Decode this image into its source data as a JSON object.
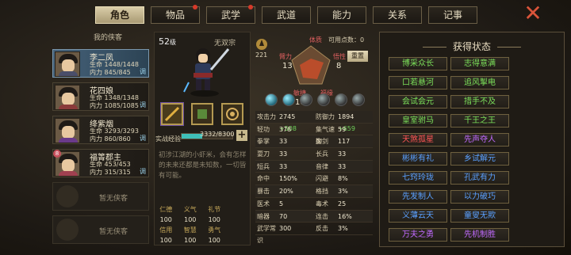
{
  "tabs": [
    {
      "label": "角色",
      "active": true
    },
    {
      "label": "物品",
      "dot": true
    },
    {
      "label": "武学",
      "dot": true
    },
    {
      "label": "武道"
    },
    {
      "label": "能力"
    },
    {
      "label": "关系"
    },
    {
      "label": "记事"
    }
  ],
  "close_icon": "close-icon",
  "party": {
    "title": "我的侠客",
    "members": [
      {
        "name": "李二凤",
        "hp": "生命 1448/1448",
        "mp": "内力 845/845",
        "tag": "调",
        "selected": true
      },
      {
        "name": "花四娘",
        "hp": "生命 1348/1348",
        "mp": "内力 1085/1085",
        "tag": "调"
      },
      {
        "name": "绛紫烟",
        "hp": "生命 3293/3293",
        "mp": "内力 860/860",
        "tag": "调"
      },
      {
        "name": "福箐郡主",
        "hp": "生命 453/453",
        "mp": "内力 315/315",
        "tag": "调",
        "badge": "8"
      }
    ],
    "empty_label": "暂无侠客"
  },
  "hero": {
    "level": "52",
    "level_unit": "级",
    "sect": "无双宗",
    "xp_label": "实战经验",
    "xp_text": "3332/8300",
    "xp_fraction": 0.401,
    "bio": "初涉江湖的小虾米，会有怎样的未来还都是未知数，一切皆有可能。"
  },
  "virtues": [
    {
      "k": "仁德",
      "v": "100"
    },
    {
      "k": "义气",
      "v": "100"
    },
    {
      "k": "礼节",
      "v": "100"
    },
    {
      "k": "",
      "v": ""
    },
    {
      "k": "信用",
      "v": "100"
    },
    {
      "k": "智慧",
      "v": "100"
    },
    {
      "k": "勇气",
      "v": "100"
    },
    {
      "k": "",
      "v": ""
    }
  ],
  "attributes": {
    "fame": "221",
    "points_label": "可用点数：0",
    "reset_label": "重置",
    "items": [
      {
        "k": "体质",
        "v": ""
      },
      {
        "k": "臂力",
        "v": "13"
      },
      {
        "k": "悟性",
        "v": "8"
      },
      {
        "k": "敏捷",
        "v": "10"
      },
      {
        "k": "福缘",
        "v": "9"
      }
    ]
  },
  "stats": [
    {
      "k": "攻击力",
      "v": "2745",
      "plus": "+508",
      "k2": "防御力",
      "v2": "1894",
      "plus2": "+659"
    },
    {
      "k": "轻功",
      "v": "378",
      "k2": "集气速度",
      "v2": "59"
    },
    {
      "k": "拳掌",
      "v": "33",
      "k2": "御剑",
      "v2": "117"
    },
    {
      "k": "耍刀",
      "v": "33",
      "k2": "长兵",
      "v2": "33"
    },
    {
      "k": "短兵",
      "v": "33",
      "k2": "音律",
      "v2": "33"
    },
    {
      "k": "命中",
      "v": "150%",
      "k2": "闪避",
      "v2": "8%"
    },
    {
      "k": "暴击",
      "v": "20%",
      "k2": "格挡",
      "v2": "3%"
    },
    {
      "k": "医术",
      "v": "5",
      "k2": "毒术",
      "v2": "25"
    },
    {
      "k": "暗器",
      "v": "70",
      "k2": "连击",
      "v2": "16%"
    },
    {
      "k": "武学常识",
      "v": "300",
      "k2": "反击",
      "v2": "3%"
    }
  ],
  "status": {
    "title": "获得状态",
    "items": [
      {
        "label": "博采众长",
        "color": "green"
      },
      {
        "label": "志得意满",
        "color": "green"
      },
      {
        "label": "口若悬河",
        "color": "green"
      },
      {
        "label": "追风掣电",
        "color": "green"
      },
      {
        "label": "会试会元",
        "color": "green"
      },
      {
        "label": "措手不及",
        "color": "green"
      },
      {
        "label": "皇室驸马",
        "color": "green"
      },
      {
        "label": "千王之王",
        "color": "green"
      },
      {
        "label": "天煞孤星",
        "color": "red"
      },
      {
        "label": "先声夺人",
        "color": "purple"
      },
      {
        "label": "彬彬有礼",
        "color": "blue"
      },
      {
        "label": "乡试解元",
        "color": "blue"
      },
      {
        "label": "七窍玲珑",
        "color": "blue"
      },
      {
        "label": "孔武有力",
        "color": "blue"
      },
      {
        "label": "先发制人",
        "color": "blue"
      },
      {
        "label": "以力破巧",
        "color": "blue"
      },
      {
        "label": "义薄云天",
        "color": "blue"
      },
      {
        "label": "童叟无欺",
        "color": "blue"
      },
      {
        "label": "万夫之勇",
        "color": "purple"
      },
      {
        "label": "先机制胜",
        "color": "purple"
      }
    ]
  },
  "colors": {
    "green": "#7be05a",
    "blue": "#5aa0ff",
    "purple": "#c06aff",
    "red": "#ff5555",
    "xp": "#3fbfb8"
  }
}
